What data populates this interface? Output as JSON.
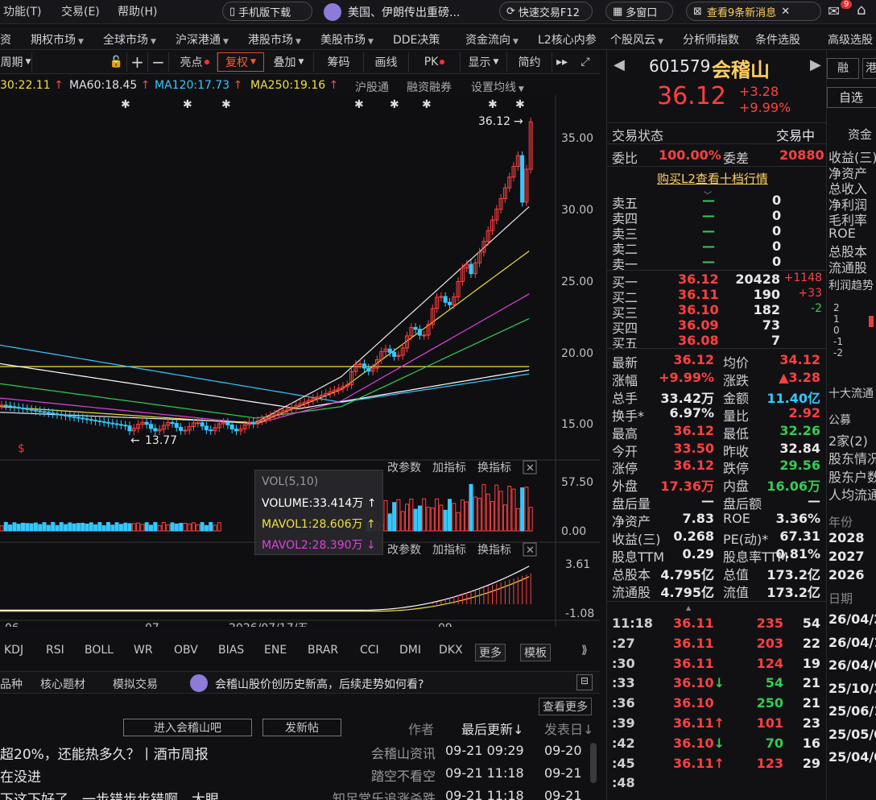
{
  "topbar": {
    "menu": [
      "功能(T)",
      "交易(E)",
      "帮助(H)"
    ],
    "mobile_download": "手机版下载",
    "news_ticker": "美国、伊朗传出重磅...",
    "quick_trade": "快速交易F12",
    "multi_window": "多窗口",
    "messages": "查看9条新消息",
    "mail_badge": "9"
  },
  "navbar": [
    "资",
    "期权市场",
    "全球市场",
    "沪深港通",
    "港股市场",
    "美股市场",
    "DDE决策",
    "资金流向",
    "L2核心内参",
    "个股风云",
    "分析师指数",
    "条件选股",
    "高级选股"
  ],
  "toolbar": {
    "period": "周期",
    "buttons": [
      "亮点",
      "复权",
      "叠加",
      "筹码",
      "画线",
      "PK",
      "显示",
      "简约"
    ]
  },
  "ma_line": {
    "ma30": "30:22.11",
    "ma60": "MA60:18.45",
    "ma120": "MA120:17.73",
    "ma250": "MA250:19.16",
    "links": [
      "沪股通",
      "融资融券",
      "设置均线"
    ]
  },
  "chart": {
    "price_axis": [
      "35.00",
      "30.00",
      "25.00",
      "20.00",
      "15.00"
    ],
    "last_price_label": "36.12",
    "low_label": "13.77",
    "vol_axis": [
      "57.50",
      "0.00"
    ],
    "macd_axis": [
      "3.61",
      "-1.08"
    ],
    "sub_links": [
      "改参数",
      "加指标",
      "换指标"
    ],
    "x_labels": [
      "06",
      "07",
      "2026/07/17/五",
      "09"
    ],
    "vol_tooltip": {
      "title": "VOL(5,10)",
      "volume": "VOLUME:33.414万",
      "mavol1": "MAVOL1:28.606万",
      "mavol2": "MAVOL2:28.390万"
    }
  },
  "indicator_tabs": [
    "KDJ",
    "RSI",
    "BOLL",
    "WR",
    "OBV",
    "BIAS",
    "ENE",
    "BRAR",
    "CCI",
    "DMI",
    "DKX",
    "更多",
    "模板"
  ],
  "news_tabs": {
    "tabs": [
      "品种",
      "核心题材",
      "模拟交易"
    ],
    "ai_text": "会稽山股价创历史新高，后续走势如何看?",
    "more": "查看更多",
    "enter_bar": "进入会稽山吧",
    "post": "发新帖",
    "headers": [
      "作者",
      "最后更新",
      "发表日"
    ]
  },
  "news_rows": [
    {
      "title": "超20%，还能热多久？丨酒市周报",
      "author": "会稽山资讯",
      "updated": "09-21 09:29",
      "date": "09-20"
    },
    {
      "title": "在没进",
      "author": "踏空不看空",
      "updated": "09-21 11:18",
      "date": "09-21"
    },
    {
      "title": "下这下好了，一步错步步错啊，大眼",
      "author": "知足常乐追涨杀跌",
      "updated": "09-21 11:18",
      "date": "09-21"
    }
  ],
  "quote": {
    "code": "601579",
    "name": "会稽山",
    "price": "36.12",
    "change": "+3.28",
    "change_pct": "+9.99%",
    "side_buttons": [
      "融",
      "港",
      "自选"
    ],
    "status_label": "交易状态",
    "status": "交易中",
    "weibi_label": "委比",
    "weibi": "100.00%",
    "weicha_label": "委差",
    "weicha": "20880",
    "l2_link": "购买L2查看十档行情",
    "sells": [
      {
        "label": "卖五",
        "price": "—",
        "vol": "0"
      },
      {
        "label": "卖四",
        "price": "—",
        "vol": "0"
      },
      {
        "label": "卖三",
        "price": "—",
        "vol": "0"
      },
      {
        "label": "卖二",
        "price": "—",
        "vol": "0"
      },
      {
        "label": "卖一",
        "price": "—",
        "vol": "0"
      }
    ],
    "buys": [
      {
        "label": "买一",
        "price": "36.12",
        "vol": "20428",
        "chg": "+1148"
      },
      {
        "label": "买二",
        "price": "36.11",
        "vol": "190",
        "chg": "+33"
      },
      {
        "label": "买三",
        "price": "36.10",
        "vol": "182",
        "chg": "-2"
      },
      {
        "label": "买四",
        "price": "36.09",
        "vol": "73",
        "chg": ""
      },
      {
        "label": "买五",
        "price": "36.08",
        "vol": "7",
        "chg": ""
      }
    ],
    "stats": [
      [
        "最新",
        "36.12",
        "均价",
        "34.12"
      ],
      [
        "涨幅",
        "+9.99%",
        "涨跌",
        "▲3.28"
      ],
      [
        "总手",
        "33.42万",
        "金额",
        "11.40亿"
      ],
      [
        "换手*",
        "6.97%",
        "量比",
        "2.92"
      ],
      [
        "最高",
        "36.12",
        "最低",
        "32.26"
      ],
      [
        "今开",
        "33.50",
        "昨收",
        "32.84"
      ],
      [
        "涨停",
        "36.12",
        "跌停",
        "29.56"
      ],
      [
        "外盘",
        "17.36万",
        "内盘",
        "16.06万"
      ],
      [
        "盘后量",
        "—",
        "盘后额",
        "—"
      ],
      [
        "净资产",
        "7.83",
        "ROE",
        "3.36%"
      ],
      [
        "收益(三)",
        "0.268",
        "PE(动)*",
        "67.31"
      ],
      [
        "股息TTM",
        "0.29",
        "股息率TTM",
        "0.81%"
      ],
      [
        "总股本",
        "4.795亿",
        "总值",
        "173.2亿"
      ],
      [
        "流通股",
        "4.795亿",
        "流值",
        "173.2亿"
      ]
    ],
    "ticks": [
      {
        "time": "11:18",
        "price": "36.11",
        "arrow": "",
        "vol": "235",
        "n": "54"
      },
      {
        "time": ":27",
        "price": "36.11",
        "arrow": "",
        "vol": "203",
        "n": "22"
      },
      {
        "time": ":30",
        "price": "36.11",
        "arrow": "",
        "vol": "124",
        "n": "19"
      },
      {
        "time": ":33",
        "price": "36.10",
        "arrow": "↓",
        "vol": "54",
        "n": "21"
      },
      {
        "time": ":36",
        "price": "36.10",
        "arrow": "",
        "vol": "250",
        "n": "21"
      },
      {
        "time": ":39",
        "price": "36.11",
        "arrow": "↑",
        "vol": "101",
        "n": "23"
      },
      {
        "time": ":42",
        "price": "36.10",
        "arrow": "↓",
        "vol": "70",
        "n": "16"
      },
      {
        "time": ":45",
        "price": "36.11",
        "arrow": "↑",
        "vol": "123",
        "n": "29"
      },
      {
        "time": ":48",
        "price": "",
        "arrow": "",
        "vol": "",
        "n": ""
      }
    ]
  },
  "far_right": {
    "tab": "资金",
    "items": [
      "收益(三)",
      "净资产",
      "总收入",
      "净利润",
      "毛利率",
      "ROE",
      "总股本",
      "流通股"
    ],
    "trend_title": "利润趋势",
    "trend_axis": [
      "2",
      "1",
      "0",
      "-1",
      "-2"
    ],
    "holders_title": "十大流通",
    "holders": [
      "公募",
      "2家(2)",
      "股东情况",
      "股东户数",
      "人均流通"
    ],
    "years_title": "年份",
    "years": [
      "2028",
      "2027",
      "2026"
    ],
    "dates_title": "日期",
    "dates": [
      "26/04/2",
      "26/04/1",
      "26/04/0",
      "25/10/3",
      "25/06/1",
      "25/05/0",
      "25/04/0"
    ]
  }
}
